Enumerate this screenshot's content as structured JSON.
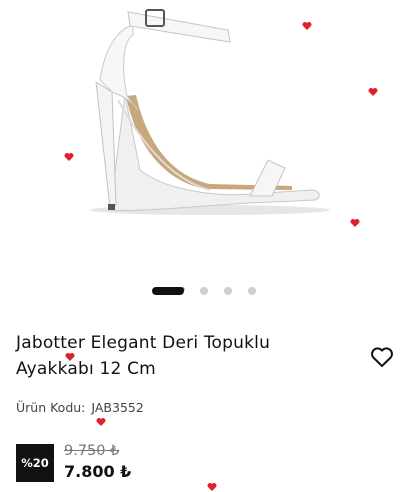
{
  "product": {
    "title_line1": "Jabotter Elegant Deri Topuklu",
    "title_line2": "Ayakkabı 12 Cm",
    "code_label": "Ürün Kodu:",
    "code_value": "JAB3552",
    "discount": "%20",
    "old_price": "9.750 ₺",
    "new_price": "7.800 ₺"
  },
  "carousel": {
    "count": 4,
    "active_index": 0
  },
  "icons": {
    "wishlist": "heart-outline-icon",
    "decoration": "heart-icon"
  },
  "colors": {
    "heart": "#e0212b",
    "dark": "#111111",
    "muted": "#777777"
  }
}
